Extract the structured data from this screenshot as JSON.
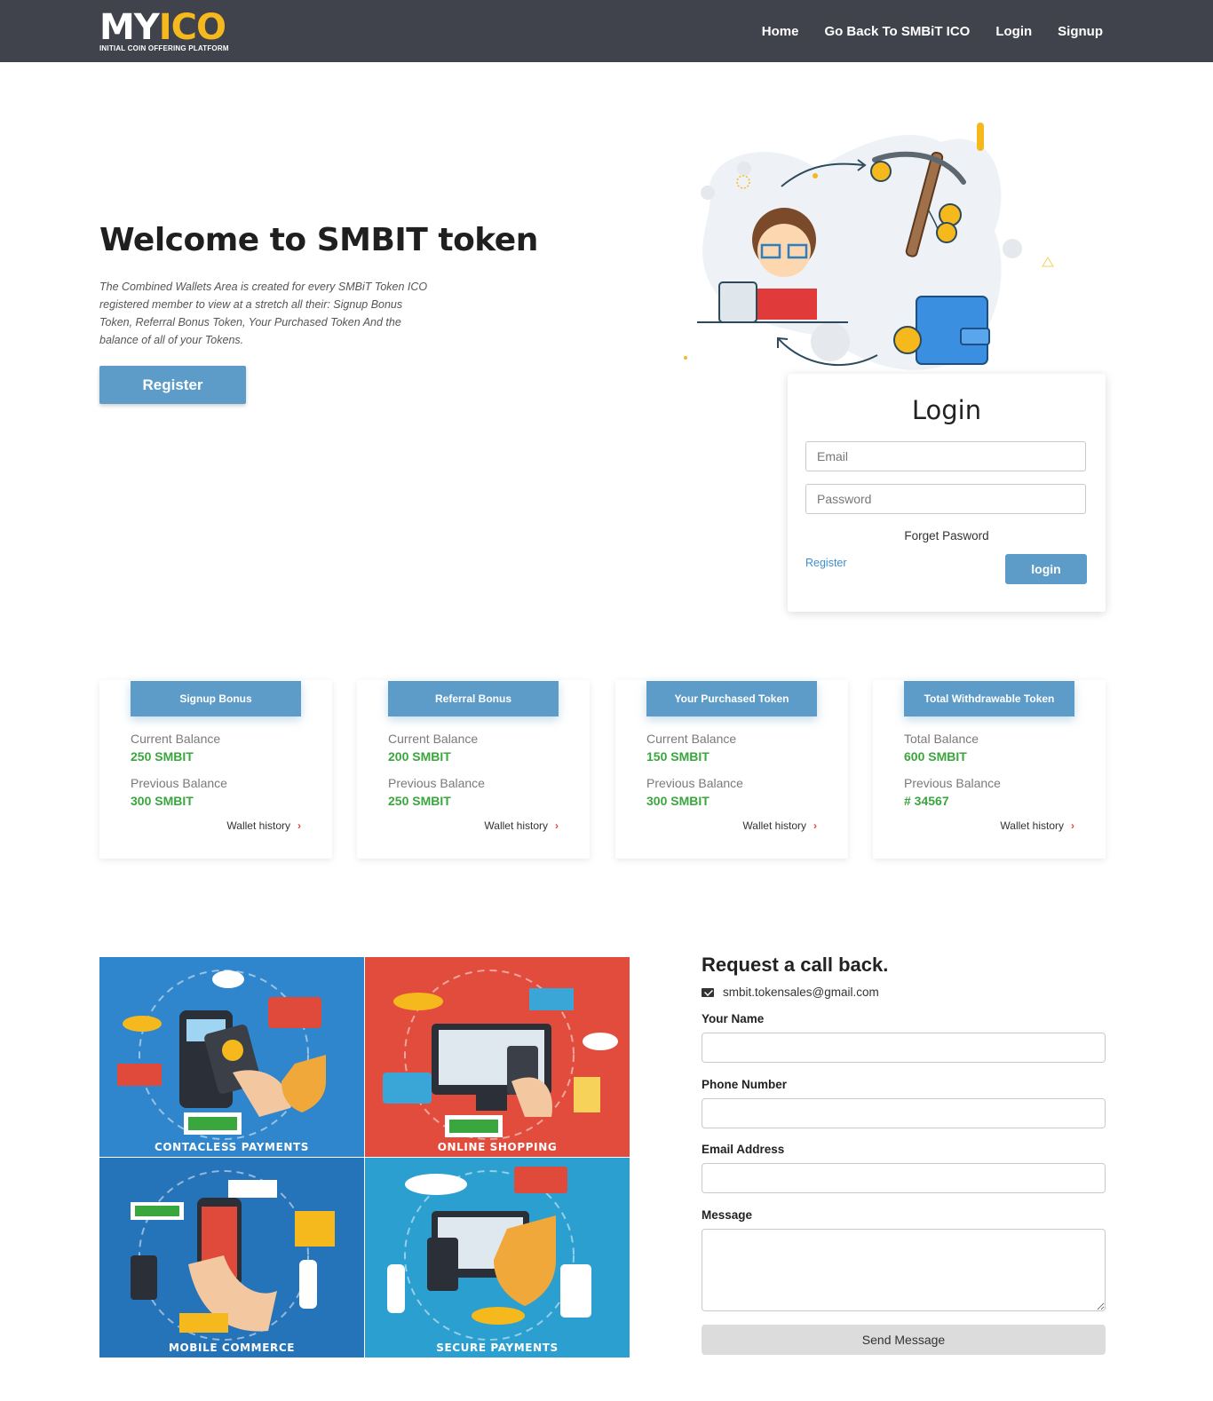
{
  "navbar": {
    "logo_main": "MY",
    "logo_accent": "ICO",
    "logo_tagline": "INITIAL COIN OFFERING PLATFORM",
    "links": [
      "Home",
      "Go Back To SMBiT ICO",
      "Login",
      "Signup"
    ]
  },
  "hero": {
    "title": "Welcome to SMBIT token",
    "description": "The Combined Wallets Area is created for every SMBiT Token ICO registered member to view at a stretch all their: Signup Bonus Token, Referral Bonus Token, Your Purchased Token And the balance of all of your Tokens.",
    "register_label": "Register"
  },
  "login": {
    "title": "Login",
    "email_placeholder": "Email",
    "password_placeholder": "Password",
    "forget_label": "Forget Pasword",
    "register_link": "Register",
    "login_button": "login"
  },
  "tokens": [
    {
      "header": "Signup Bonus",
      "label1": "Current Balance",
      "value1": "250 SMBIT",
      "label2": "Previous Balance",
      "value2": "300 SMBIT",
      "link": "Wallet history"
    },
    {
      "header": "Referral Bonus",
      "label1": "Current Balance",
      "value1": "200 SMBIT",
      "label2": "Previous Balance",
      "value2": "250 SMBIT",
      "link": "Wallet history"
    },
    {
      "header": "Your Purchased Token",
      "label1": "Current Balance",
      "value1": "150 SMBIT",
      "label2": "Previous Balance",
      "value2": "300 SMBIT",
      "link": "Wallet history"
    },
    {
      "header": "Total Withdrawable Token",
      "label1": "Total Balance",
      "value1": "600 SMBIT",
      "label2": "Previous Balance",
      "value2": "# 34567",
      "link": "Wallet history"
    }
  ],
  "payments": {
    "tiles": [
      "CONTACLESS PAYMENTS",
      "ONLINE SHOPPING",
      "MOBILE COMMERCE",
      "SECURE PAYMENTS"
    ]
  },
  "callback": {
    "title": "Request a call back.",
    "email": "smbit.tokensales@gmail.com",
    "name_label": "Your Name",
    "phone_label": "Phone Number",
    "email_label": "Email Address",
    "message_label": "Message",
    "send_label": "Send Message"
  },
  "colors": {
    "navbar": "#40434b",
    "accent": "#5d9cc9",
    "logo_accent": "#f6b91d",
    "balance_green": "#3aa63e",
    "link_blue": "#3d8fd0"
  }
}
